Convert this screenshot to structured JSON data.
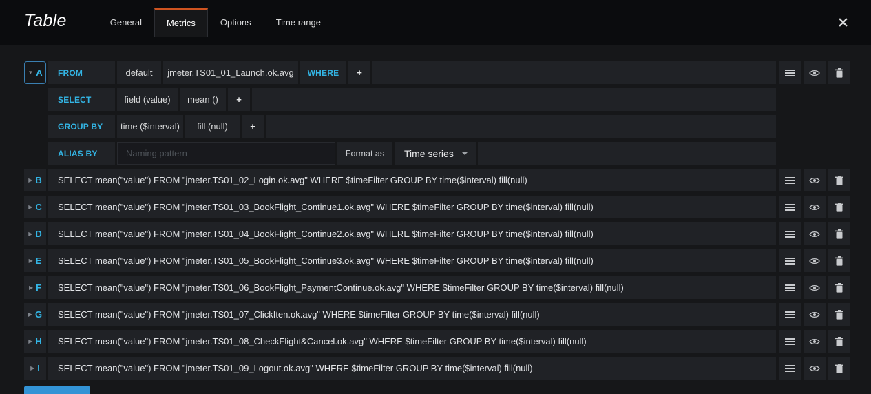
{
  "header": {
    "title": "Table",
    "tabs": [
      {
        "label": "General",
        "active": false
      },
      {
        "label": "Metrics",
        "active": true
      },
      {
        "label": "Options",
        "active": false
      },
      {
        "label": "Time range",
        "active": false
      }
    ]
  },
  "ui": {
    "plus": "+",
    "caret_collapsed": "▶",
    "caret_expanded": "▼"
  },
  "query_a": {
    "letter": "A",
    "from_keyword": "FROM",
    "datasource": "default",
    "measurement": "jmeter.TS01_01_Launch.ok.avg",
    "where_keyword": "WHERE",
    "select_keyword": "SELECT",
    "select_field": "field (value)",
    "select_func": "mean ()",
    "groupby_keyword": "GROUP BY",
    "groupby_time": "time ($interval)",
    "groupby_fill": "fill (null)",
    "alias_keyword": "ALIAS BY",
    "alias_placeholder": "Naming pattern",
    "alias_value": "",
    "format_as_label": "Format as",
    "format_as_value": "Time series"
  },
  "queries": [
    {
      "letter": "B",
      "query": "SELECT mean(\"value\") FROM \"jmeter.TS01_02_Login.ok.avg\" WHERE $timeFilter GROUP BY time($interval) fill(null)"
    },
    {
      "letter": "C",
      "query": "SELECT mean(\"value\") FROM \"jmeter.TS01_03_BookFlight_Continue1.ok.avg\" WHERE $timeFilter GROUP BY time($interval) fill(null)"
    },
    {
      "letter": "D",
      "query": "SELECT mean(\"value\") FROM \"jmeter.TS01_04_BookFlight_Continue2.ok.avg\" WHERE $timeFilter GROUP BY time($interval) fill(null)"
    },
    {
      "letter": "E",
      "query": "SELECT mean(\"value\") FROM \"jmeter.TS01_05_BookFlight_Continue3.ok.avg\" WHERE $timeFilter GROUP BY time($interval) fill(null)"
    },
    {
      "letter": "F",
      "query": "SELECT mean(\"value\") FROM \"jmeter.TS01_06_BookFlight_PaymentContinue.ok.avg\" WHERE $timeFilter GROUP BY time($interval) fill(null)"
    },
    {
      "letter": "G",
      "query": "SELECT mean(\"value\") FROM \"jmeter.TS01_07_ClickIten.ok.avg\" WHERE $timeFilter GROUP BY time($interval) fill(null)"
    },
    {
      "letter": "H",
      "query": "SELECT mean(\"value\") FROM \"jmeter.TS01_08_CheckFlight&Cancel.ok.avg\" WHERE $timeFilter GROUP BY time($interval) fill(null)"
    },
    {
      "letter": "I",
      "query": "SELECT mean(\"value\") FROM \"jmeter.TS01_09_Logout.ok.avg\" WHERE $timeFilter GROUP BY time($interval) fill(null)"
    }
  ],
  "colors": {
    "accent_blue": "#33b5e5",
    "segment_bg": "#202226",
    "header_bg": "#0b0c0e",
    "editor_bg": "#161719",
    "active_tab_top": "#cf5420",
    "add_query_blue": "#3393d5"
  }
}
